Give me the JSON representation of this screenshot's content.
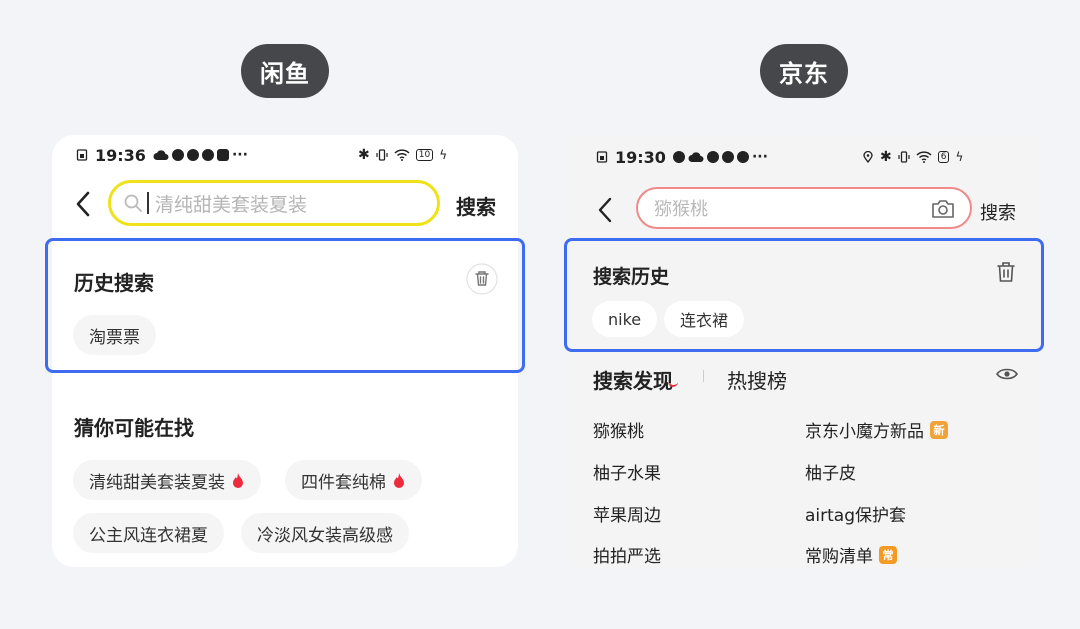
{
  "labels": {
    "left": "闲鱼",
    "right": "京东"
  },
  "xianyu": {
    "status_time": "19:36",
    "battery": "10",
    "search_placeholder": "清纯甜美套装夏装",
    "search_button": "搜索",
    "history_title": "历史搜索",
    "history_items": [
      "淘票票"
    ],
    "guess_title": "猜你可能在找",
    "guess_items": [
      "清纯甜美套装夏装",
      "四件套纯棉",
      "公主风连衣裙夏",
      "冷淡风女装高级感"
    ]
  },
  "jd": {
    "status_time": "19:30",
    "battery": "6",
    "search_placeholder": "猕猴桃",
    "search_button": "搜索",
    "history_title": "搜索历史",
    "history_items": [
      "nike",
      "连衣裙"
    ],
    "tab_discover": "搜索发现",
    "tab_hot": "热搜榜",
    "discover_items": [
      "猕猴桃",
      "京东小魔方新品",
      "柚子水果",
      "柚子皮",
      "苹果周边",
      "airtag保护套",
      "拍拍严选",
      "常购清单"
    ],
    "badge_new": "新",
    "badge_frequent": "常",
    "colors": {
      "badge_new": "#f2a23a",
      "badge_frequent": "#f59a23"
    }
  },
  "colors": {
    "highlight": "#3e6cf0",
    "xianyu_search_border": "#f0e21a",
    "jd_search_border": "#f08a8a",
    "fire": "#ee2a3d"
  }
}
